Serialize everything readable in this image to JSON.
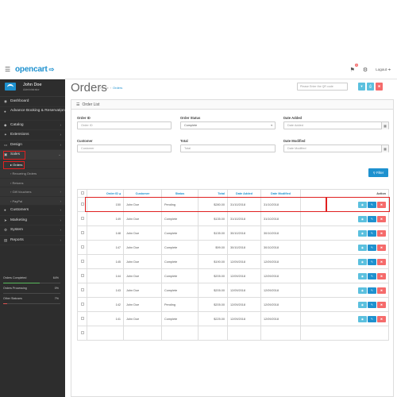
{
  "header": {
    "logo_text": "opencart",
    "logo_cart": "🛒",
    "notification_count": "1",
    "logout_label": "Logout"
  },
  "sidebar": {
    "user_name": "John Doe",
    "user_role": "Administrator",
    "items": [
      {
        "label": "Dashboard",
        "icon": "dashboard-icon"
      },
      {
        "label": "Advance Booking & Reservation",
        "icon": "user-icon"
      },
      {
        "label": "Catalog",
        "icon": "tag-icon"
      },
      {
        "label": "Extensions",
        "icon": "puzzle-icon"
      },
      {
        "label": "Design",
        "icon": "monitor-icon"
      },
      {
        "label": "Sales",
        "icon": "cart-icon"
      },
      {
        "label": "Customers",
        "icon": "user-icon"
      },
      {
        "label": "Marketing",
        "icon": "share-icon"
      },
      {
        "label": "System",
        "icon": "gear-icon"
      },
      {
        "label": "Reports",
        "icon": "bar-chart-icon"
      }
    ],
    "sales_sub": [
      {
        "label": "Orders"
      },
      {
        "label": "Recurring Orders"
      },
      {
        "label": "Returns"
      },
      {
        "label": "Gift Vouchers"
      },
      {
        "label": "PayPal"
      }
    ],
    "status": [
      {
        "label": "Orders Completed",
        "pct": "64%",
        "value": 0.64,
        "color": "#59b95d"
      },
      {
        "label": "Orders Processing",
        "pct": "0%",
        "value": 0.0,
        "color": "#f0ad4e"
      },
      {
        "label": "Other Statuses",
        "pct": "7%",
        "value": 0.07,
        "color": "#d9534f"
      }
    ]
  },
  "main": {
    "title": "Orders",
    "breadcrumb": [
      "Home",
      "Orders"
    ],
    "qr_placeholder": "Please Enter the QR code",
    "panel_title": "Order List",
    "filter": {
      "order_id_label": "Order ID",
      "order_id_placeholder": "Order ID",
      "order_status_label": "Order Status",
      "order_status_value": "Complete",
      "date_added_label": "Date Added",
      "date_added_placeholder": "Date Added",
      "customer_label": "Customer",
      "customer_placeholder": "Customer",
      "total_label": "Total",
      "total_placeholder": "Total",
      "date_modified_label": "Date Modified",
      "date_modified_placeholder": "Date Modified",
      "filter_button": "Filter"
    },
    "table": {
      "headers": {
        "order_id": "Order ID ▴",
        "customer": "Customer",
        "status": "Status",
        "total": "Total",
        "date_added": "Date Added",
        "date_modified": "Date Modified",
        "action": "Action"
      },
      "rows": [
        {
          "id": "150",
          "customer": "John Doe",
          "status": "Pending",
          "total": "$280.00",
          "added": "31/10/2018",
          "modified": "31/10/2018"
        },
        {
          "id": "149",
          "customer": "John Doe",
          "status": "Complete",
          "total": "$135.00",
          "added": "31/10/2018",
          "modified": "31/10/2018"
        },
        {
          "id": "148",
          "customer": "John Doe",
          "status": "Complete",
          "total": "$135.00",
          "added": "30/10/2018",
          "modified": "30/10/2018"
        },
        {
          "id": "147",
          "customer": "John Doe",
          "status": "Complete",
          "total": "$99.00",
          "added": "30/10/2018",
          "modified": "30/10/2018"
        },
        {
          "id": "145",
          "customer": "John Doe",
          "status": "Complete",
          "total": "$190.00",
          "added": "12/09/2018",
          "modified": "12/09/2018"
        },
        {
          "id": "144",
          "customer": "John Doe",
          "status": "Complete",
          "total": "$205.00",
          "added": "12/09/2018",
          "modified": "12/09/2018"
        },
        {
          "id": "143",
          "customer": "John Doe",
          "status": "Complete",
          "total": "$205.00",
          "added": "12/09/2018",
          "modified": "12/09/2018"
        },
        {
          "id": "142",
          "customer": "John Doe",
          "status": "Pending",
          "total": "$205.00",
          "added": "12/09/2018",
          "modified": "12/09/2018"
        },
        {
          "id": "141",
          "customer": "John Doe",
          "status": "Complete",
          "total": "$225.00",
          "added": "12/09/2018",
          "modified": "12/09/2018"
        },
        {
          "id": "",
          "customer": "",
          "status": "",
          "total": "",
          "added": "",
          "modified": ""
        }
      ]
    }
  }
}
